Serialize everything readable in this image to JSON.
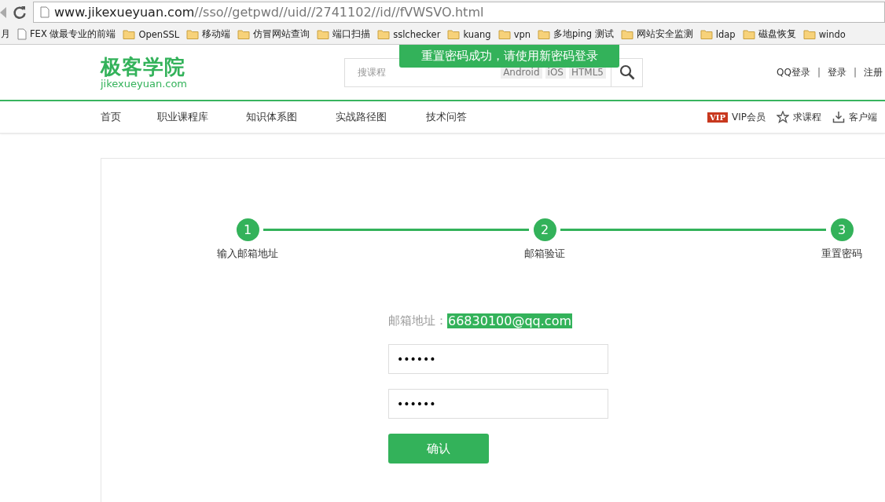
{
  "browser": {
    "url": {
      "host": "www.jikexueyuan.com",
      "path": "//sso//getpwd//uid//2741102//id//fVWSVO.html"
    },
    "bookmarks": [
      {
        "label": "月",
        "kind": "none"
      },
      {
        "label": "FEX 做最专业的前端",
        "kind": "page"
      },
      {
        "label": "OpenSSL",
        "kind": "folder"
      },
      {
        "label": "移动端",
        "kind": "folder"
      },
      {
        "label": "仿冒网站查询",
        "kind": "folder"
      },
      {
        "label": "端口扫描",
        "kind": "folder"
      },
      {
        "label": "sslchecker",
        "kind": "folder"
      },
      {
        "label": "kuang",
        "kind": "folder"
      },
      {
        "label": "vpn",
        "kind": "folder"
      },
      {
        "label": "多地ping 测试",
        "kind": "folder"
      },
      {
        "label": "网站安全监测",
        "kind": "folder"
      },
      {
        "label": "ldap",
        "kind": "folder"
      },
      {
        "label": "磁盘恢复",
        "kind": "folder"
      },
      {
        "label": "windo",
        "kind": "folder"
      }
    ]
  },
  "toast": "重置密码成功，请使用新密码登录",
  "header": {
    "logo": {
      "name": "极客学院",
      "domain": "jikexueyuan.com"
    },
    "search": {
      "placeholder": "搜课程",
      "tags": [
        "Android",
        "iOS",
        "HTML5"
      ]
    },
    "account_links": [
      "QQ登录",
      "登录",
      "注册"
    ],
    "separator": "|"
  },
  "nav": {
    "items": [
      "首页",
      "职业课程库",
      "知识体系图",
      "实战路径图",
      "技术问答"
    ],
    "right": [
      {
        "kind": "vip",
        "badge": "VIP",
        "label": "VIP会员"
      },
      {
        "kind": "request",
        "label": "求课程"
      },
      {
        "kind": "download",
        "label": "客户端"
      }
    ]
  },
  "steps": [
    {
      "number": "1",
      "label": "输入邮箱地址",
      "done": true
    },
    {
      "number": "2",
      "label": "邮箱验证",
      "done": true
    },
    {
      "number": "3",
      "label": "重置密码",
      "done": true
    }
  ],
  "form": {
    "email_label": "邮箱地址：",
    "email": "66830100@qq.com",
    "fields": [
      {
        "value": "••••••"
      },
      {
        "value": "••••••"
      }
    ],
    "submit": "确认"
  }
}
